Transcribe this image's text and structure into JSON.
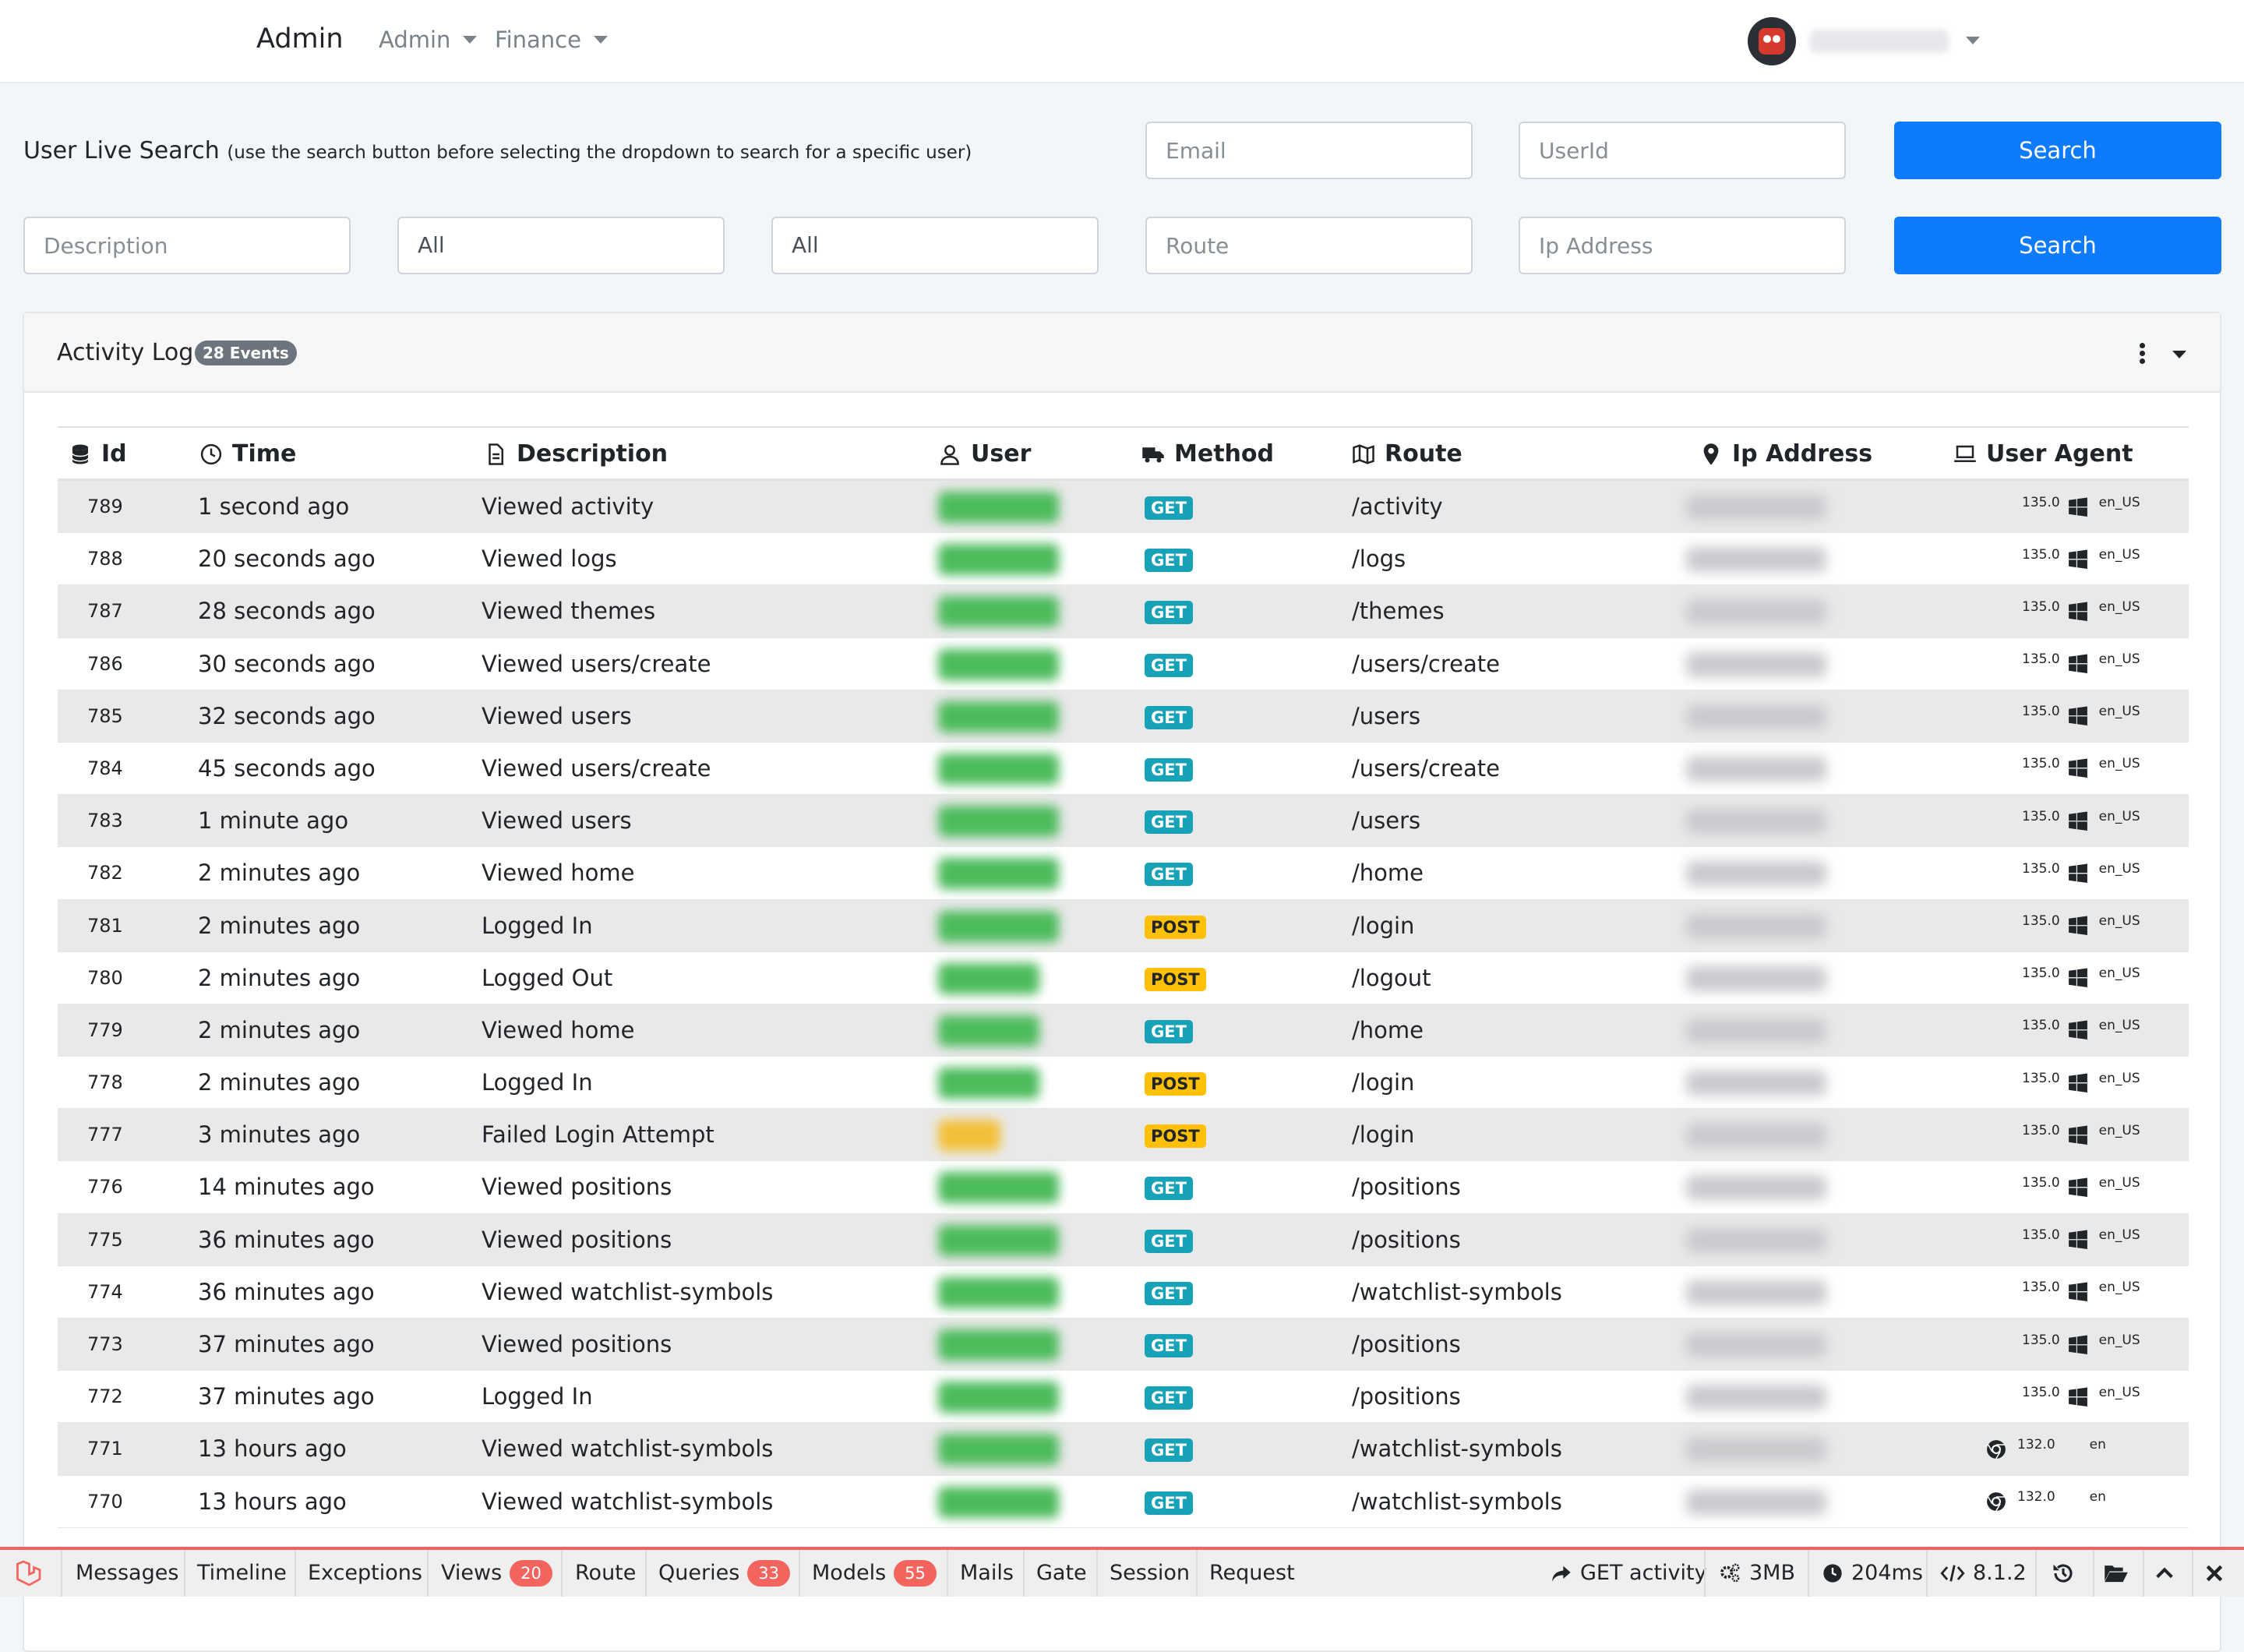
{
  "navbar": {
    "brand": "Admin",
    "menus": [
      "Admin",
      "Finance"
    ]
  },
  "search": {
    "title": "User Live Search",
    "hint": "(use the search button before selecting the dropdown to search for a specific user)",
    "email_placeholder": "Email",
    "userid_placeholder": "UserId",
    "description_placeholder": "Description",
    "select1_value": "All",
    "select2_value": "All",
    "route_placeholder": "Route",
    "ip_placeholder": "Ip Address",
    "button_label": "Search"
  },
  "card": {
    "title": "Activity Log",
    "badge": "28 Events"
  },
  "table": {
    "headers": {
      "id": "Id",
      "time": "Time",
      "description": "Description",
      "user": "User",
      "method": "Method",
      "route": "Route",
      "ip": "Ip Address",
      "user_agent": "User Agent"
    },
    "rows": [
      {
        "id": "789",
        "time": "1 second ago",
        "description": "Viewed activity",
        "method": "GET",
        "route": "/activity",
        "ua_version": "135.0",
        "ua_os": "windows-icon",
        "ua_lang": "en_US"
      },
      {
        "id": "788",
        "time": "20 seconds ago",
        "description": "Viewed logs",
        "method": "GET",
        "route": "/logs",
        "ua_version": "135.0",
        "ua_os": "windows-icon",
        "ua_lang": "en_US"
      },
      {
        "id": "787",
        "time": "28 seconds ago",
        "description": "Viewed themes",
        "method": "GET",
        "route": "/themes",
        "ua_version": "135.0",
        "ua_os": "windows-icon",
        "ua_lang": "en_US"
      },
      {
        "id": "786",
        "time": "30 seconds ago",
        "description": "Viewed users/create",
        "method": "GET",
        "route": "/users/create",
        "ua_version": "135.0",
        "ua_os": "windows-icon",
        "ua_lang": "en_US"
      },
      {
        "id": "785",
        "time": "32 seconds ago",
        "description": "Viewed users",
        "method": "GET",
        "route": "/users",
        "ua_version": "135.0",
        "ua_os": "windows-icon",
        "ua_lang": "en_US"
      },
      {
        "id": "784",
        "time": "45 seconds ago",
        "description": "Viewed users/create",
        "method": "GET",
        "route": "/users/create",
        "ua_version": "135.0",
        "ua_os": "windows-icon",
        "ua_lang": "en_US"
      },
      {
        "id": "783",
        "time": "1 minute ago",
        "description": "Viewed users",
        "method": "GET",
        "route": "/users",
        "ua_version": "135.0",
        "ua_os": "windows-icon",
        "ua_lang": "en_US"
      },
      {
        "id": "782",
        "time": "2 minutes ago",
        "description": "Viewed home",
        "method": "GET",
        "route": "/home",
        "ua_version": "135.0",
        "ua_os": "windows-icon",
        "ua_lang": "en_US"
      },
      {
        "id": "781",
        "time": "2 minutes ago",
        "description": "Logged In",
        "method": "POST",
        "route": "/login",
        "ua_version": "135.0",
        "ua_os": "windows-icon",
        "ua_lang": "en_US"
      },
      {
        "id": "780",
        "time": "2 minutes ago",
        "description": "Logged Out",
        "method": "POST",
        "route": "/logout",
        "ua_version": "135.0",
        "ua_os": "windows-icon",
        "ua_lang": "en_US"
      },
      {
        "id": "779",
        "time": "2 minutes ago",
        "description": "Viewed home",
        "method": "GET",
        "route": "/home",
        "ua_version": "135.0",
        "ua_os": "windows-icon",
        "ua_lang": "en_US"
      },
      {
        "id": "778",
        "time": "2 minutes ago",
        "description": "Logged In",
        "method": "POST",
        "route": "/login",
        "ua_version": "135.0",
        "ua_os": "windows-icon",
        "ua_lang": "en_US"
      },
      {
        "id": "777",
        "time": "3 minutes ago",
        "description": "Failed Login Attempt",
        "method": "POST",
        "route": "/login",
        "ua_version": "135.0",
        "ua_os": "windows-icon",
        "ua_lang": "en_US"
      },
      {
        "id": "776",
        "time": "14 minutes ago",
        "description": "Viewed positions",
        "method": "GET",
        "route": "/positions",
        "ua_version": "135.0",
        "ua_os": "windows-icon",
        "ua_lang": "en_US"
      },
      {
        "id": "775",
        "time": "36 minutes ago",
        "description": "Viewed positions",
        "method": "GET",
        "route": "/positions",
        "ua_version": "135.0",
        "ua_os": "windows-icon",
        "ua_lang": "en_US"
      },
      {
        "id": "774",
        "time": "36 minutes ago",
        "description": "Viewed watchlist-symbols",
        "method": "GET",
        "route": "/watchlist-symbols",
        "ua_version": "135.0",
        "ua_os": "windows-icon",
        "ua_lang": "en_US"
      },
      {
        "id": "773",
        "time": "37 minutes ago",
        "description": "Viewed positions",
        "method": "GET",
        "route": "/positions",
        "ua_version": "135.0",
        "ua_os": "windows-icon",
        "ua_lang": "en_US"
      },
      {
        "id": "772",
        "time": "37 minutes ago",
        "description": "Logged In",
        "method": "GET",
        "route": "/positions",
        "ua_version": "135.0",
        "ua_os": "windows-icon",
        "ua_lang": "en_US"
      },
      {
        "id": "771",
        "time": "13 hours ago",
        "description": "Viewed watchlist-symbols",
        "method": "GET",
        "route": "/watchlist-symbols",
        "ua_version": "132.0",
        "ua_os": "chrome-icon",
        "ua_lang": "en"
      },
      {
        "id": "770",
        "time": "13 hours ago",
        "description": "Viewed watchlist-symbols",
        "method": "GET",
        "route": "/watchlist-symbols",
        "ua_version": "132.0",
        "ua_os": "chrome-icon",
        "ua_lang": "en"
      }
    ]
  },
  "debugbar": {
    "tabs": [
      "Messages",
      "Timeline",
      "Exceptions",
      "Views",
      "Route",
      "Queries",
      "Models",
      "Mails",
      "Gate",
      "Session",
      "Request"
    ],
    "views_count": "20",
    "queries_count": "33",
    "models_count": "55",
    "request_label": "GET activity",
    "memory": "3MB",
    "duration": "204ms",
    "php_version": "8.1.2"
  },
  "colors": {
    "primary": "#0d7bfb",
    "get_badge": "#17a2b8",
    "post_badge": "#ffc107",
    "debugbar_accent": "#f4645f"
  }
}
